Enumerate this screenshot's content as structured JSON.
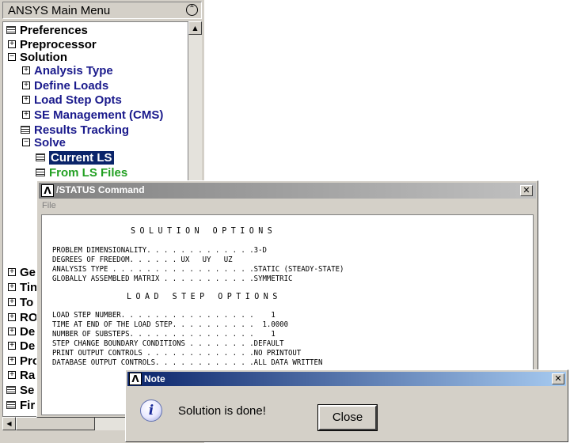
{
  "main_menu": {
    "title": "ANSYS Main Menu",
    "collapse_glyph": "⌃",
    "items": [
      {
        "label": "Preferences",
        "icon": "command-icon",
        "color": "black"
      },
      {
        "label": "Preprocessor",
        "icon": "expand-icon",
        "color": "black"
      },
      {
        "label": "Solution",
        "icon": "collapse-icon",
        "color": "black"
      },
      {
        "label": "Analysis Type",
        "icon": "expand-icon",
        "color": "navy"
      },
      {
        "label": "Define Loads",
        "icon": "expand-icon",
        "color": "navy"
      },
      {
        "label": "Load Step Opts",
        "icon": "expand-icon",
        "color": "navy"
      },
      {
        "label": "SE Management (CMS)",
        "icon": "expand-icon",
        "color": "navy"
      },
      {
        "label": "Results Tracking",
        "icon": "command-icon",
        "color": "navy"
      },
      {
        "label": "Solve",
        "icon": "collapse-icon",
        "color": "navy"
      },
      {
        "label": "Current LS",
        "icon": "command-icon",
        "color": "selected"
      },
      {
        "label": "From LS Files",
        "icon": "command-icon",
        "color": "green"
      },
      {
        "label": "Ge",
        "icon": "expand-icon",
        "color": "black"
      },
      {
        "label": "Tin",
        "icon": "expand-icon",
        "color": "black"
      },
      {
        "label": "To",
        "icon": "expand-icon",
        "color": "black"
      },
      {
        "label": "RO",
        "icon": "expand-icon",
        "color": "black"
      },
      {
        "label": "De",
        "icon": "expand-icon",
        "color": "black"
      },
      {
        "label": "De",
        "icon": "expand-icon",
        "color": "black"
      },
      {
        "label": "Pro",
        "icon": "expand-icon",
        "color": "black"
      },
      {
        "label": "Ra",
        "icon": "expand-icon",
        "color": "black"
      },
      {
        "label": "Se",
        "icon": "command-icon",
        "color": "black"
      },
      {
        "label": "Fir",
        "icon": "command-icon",
        "color": "black"
      }
    ]
  },
  "status_window": {
    "logo": "Λ",
    "title": "/STATUS  Command",
    "close_glyph": "✕",
    "menu_file": "File",
    "heading1": "SOLUTION OPTIONS",
    "lines1": [
      "PROBLEM DIMENSIONALITY. . . . . . . . . . . . .3-D",
      "DEGREES OF FREEDOM. . . . . . UX   UY   UZ",
      "ANALYSIS TYPE . . . . . . . . . . . . . . . . .STATIC (STEADY-STATE)",
      "GLOBALLY ASSEMBLED MATRIX . . . . . . . . . . .SYMMETRIC"
    ],
    "heading2": "LOAD STEP OPTIONS",
    "lines2": [
      "LOAD STEP NUMBER. . . . . . . . . . . . . . . .    1",
      "TIME AT END OF THE LOAD STEP. . . . . . . . . .  1.0000",
      "NUMBER OF SUBSTEPS. . . . . . . . . . . . . . .    1",
      "STEP CHANGE BOUNDARY CONDITIONS . . . . . . . .DEFAULT",
      "PRINT OUTPUT CONTROLS . . . . . . . . . . . . .NO PRINTOUT",
      "DATABASE OUTPUT CONTROLS. . . . . . . . . . . .ALL DATA WRITTEN"
    ]
  },
  "note_dialog": {
    "logo": "Λ",
    "title": "Note",
    "close_glyph": "✕",
    "info_glyph": "i",
    "message": "Solution is done!",
    "button_label": "Close"
  }
}
